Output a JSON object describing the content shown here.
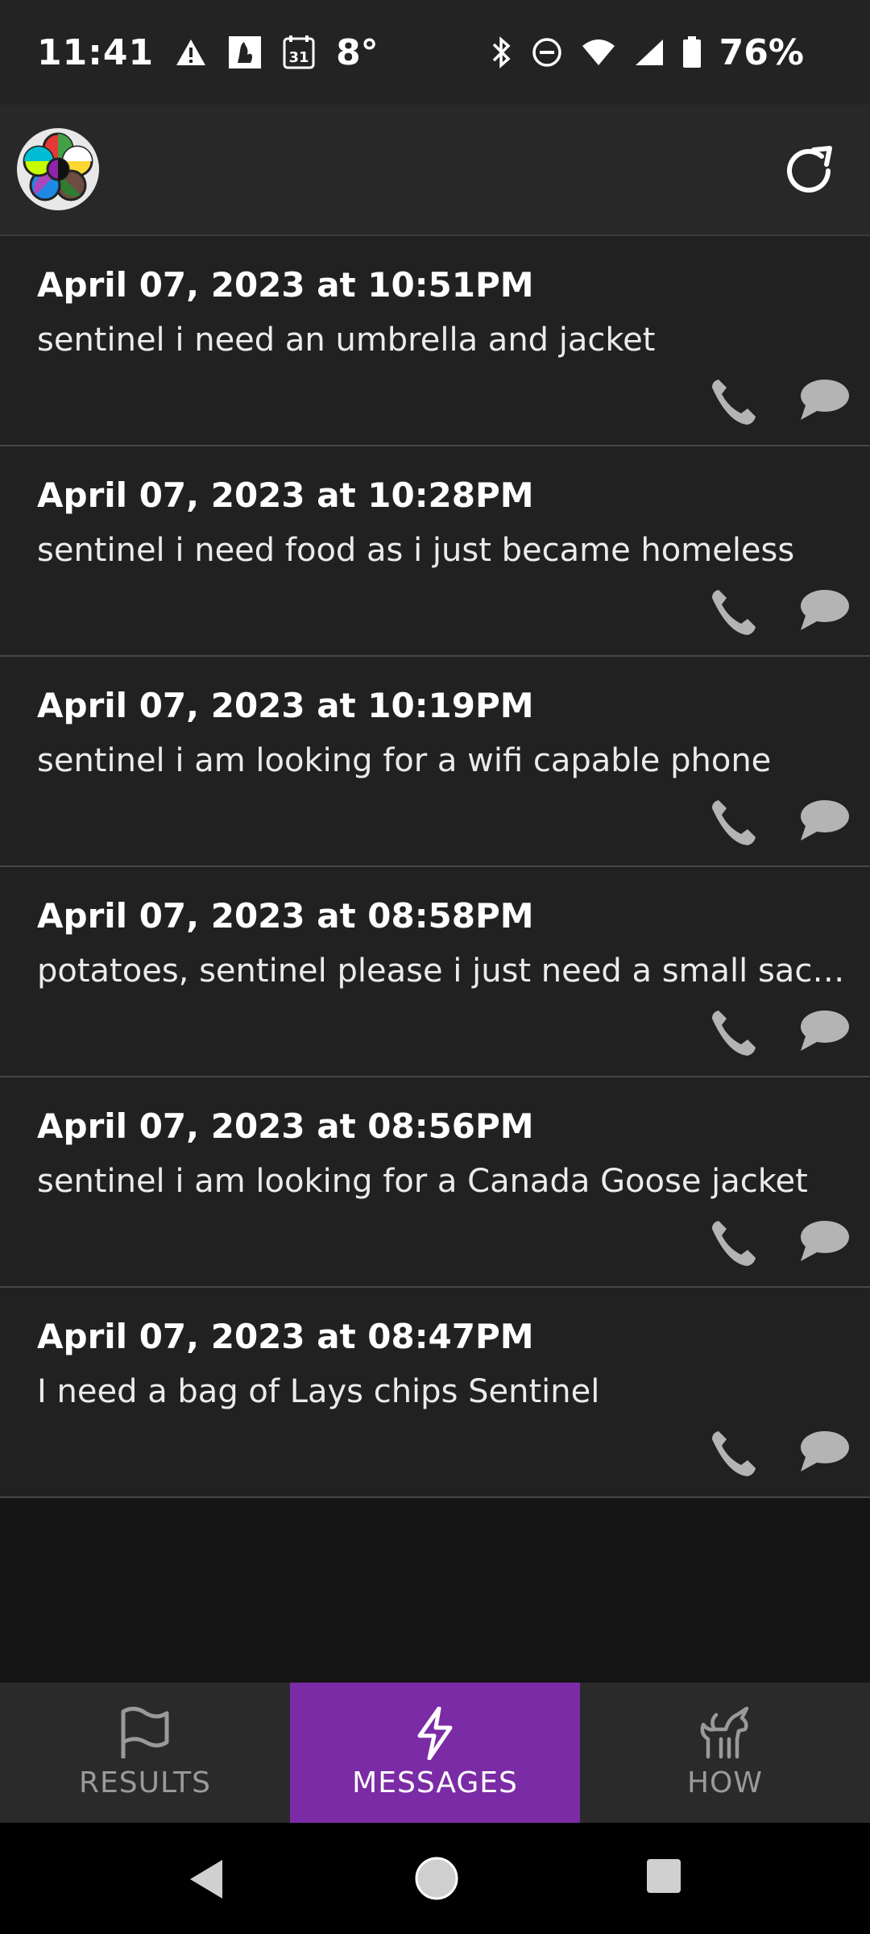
{
  "status_bar": {
    "time": "11:41",
    "temperature": "8°",
    "battery": "76%",
    "calendar_day": "31",
    "icons": [
      "alert-icon",
      "image-icon",
      "calendar-icon",
      "bluetooth-icon",
      "do-not-disturb-icon",
      "wifi-icon",
      "signal-icon",
      "battery-icon"
    ]
  },
  "header": {
    "logo_icon": "flower-logo-icon",
    "refresh_icon": "refresh-icon"
  },
  "messages": [
    {
      "date": "April 07, 2023 at 10:51PM",
      "text": "sentinel i need an umbrella and jacket"
    },
    {
      "date": "April 07, 2023 at 10:28PM",
      "text": "sentinel i need food as i just became homeless"
    },
    {
      "date": "April 07, 2023 at 10:19PM",
      "text": "sentinel i am looking for a wifi capable phone"
    },
    {
      "date": "April 07, 2023 at 08:58PM",
      "text": "potatoes, sentinel please i just need a small sack of p..."
    },
    {
      "date": "April 07, 2023 at 08:56PM",
      "text": "sentinel i am looking for a Canada Goose jacket"
    },
    {
      "date": "April 07, 2023 at 08:47PM",
      "text": "I need a bag of Lays chips Sentinel"
    }
  ],
  "bottom_nav": {
    "tabs": [
      {
        "label": "RESULTS",
        "icon": "flag-icon"
      },
      {
        "label": "MESSAGES",
        "icon": "lightning-icon"
      },
      {
        "label": "HOW",
        "icon": "unicorn-icon"
      }
    ],
    "active_tab": "MESSAGES"
  },
  "colors": {
    "accent": "#7b2ba5",
    "list_background": "#212121",
    "icon_gray": "#b4b4b4"
  }
}
